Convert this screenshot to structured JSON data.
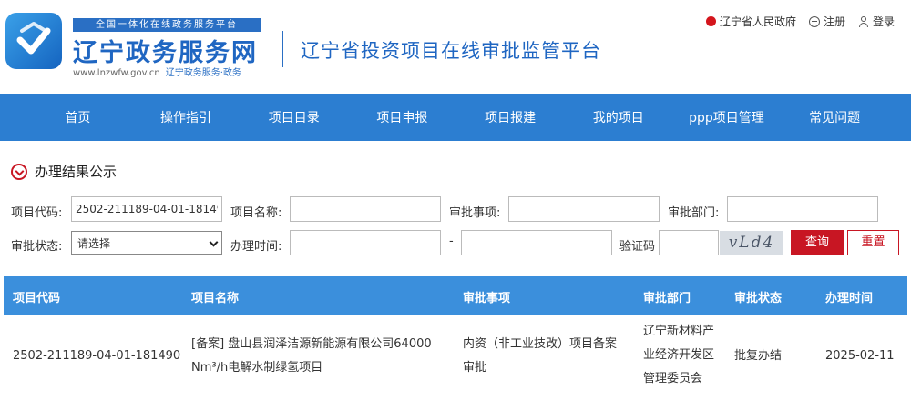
{
  "header": {
    "slogan": "全国一体化在线政务服务平台",
    "site_name": "辽宁政务服务网",
    "site_url": "www.lnzwfw.gov.cn",
    "site_url_sub": "辽宁政务服务·政务",
    "platform_title": "辽宁省投资项目在线审批监管平台",
    "links": {
      "gov": "辽宁省人民政府",
      "register": "注册",
      "login": "登录"
    }
  },
  "nav": {
    "items": [
      "首页",
      "操作指引",
      "项目目录",
      "项目申报",
      "项目报建",
      "我的项目",
      "ppp项目管理",
      "常见问题"
    ]
  },
  "section": {
    "title": "办理结果公示"
  },
  "form": {
    "project_code_label": "项目代码:",
    "project_code_value": "2502-211189-04-01-181490",
    "project_name_label": "项目名称:",
    "approval_item_label": "审批事项:",
    "approval_dept_label": "审批部门:",
    "approval_status_label": "审批状态:",
    "approval_status_value": "请选择",
    "handle_time_label": "办理时间:",
    "time_separator": "-",
    "captcha_label": "验证码",
    "captcha_text": "vLd4",
    "query_button": "查询",
    "reset_button": "重置"
  },
  "table": {
    "headers": [
      "项目代码",
      "项目名称",
      "审批事项",
      "审批部门",
      "审批状态",
      "办理时间"
    ],
    "rows": [
      {
        "code": "2502-211189-04-01-181490",
        "name_line1": "[备案] 盘山县润泽洁源新能源有限公司64000",
        "name_line2": "Nm³/h电解水制绿氢项目",
        "item_line1": "内资（非工业技改）项目备案",
        "item_line2": "审批",
        "dept_line1": "辽宁新材料产",
        "dept_line2": "业经济开发区",
        "dept_line3": "管理委员会",
        "status": "批复办结",
        "time": "2025-02-11"
      }
    ]
  },
  "colors": {
    "nav_bg": "#2c7ed1",
    "table_head_bg": "#3b8fdc",
    "brand_blue": "#1f66c2",
    "accent_red": "#c81623"
  }
}
